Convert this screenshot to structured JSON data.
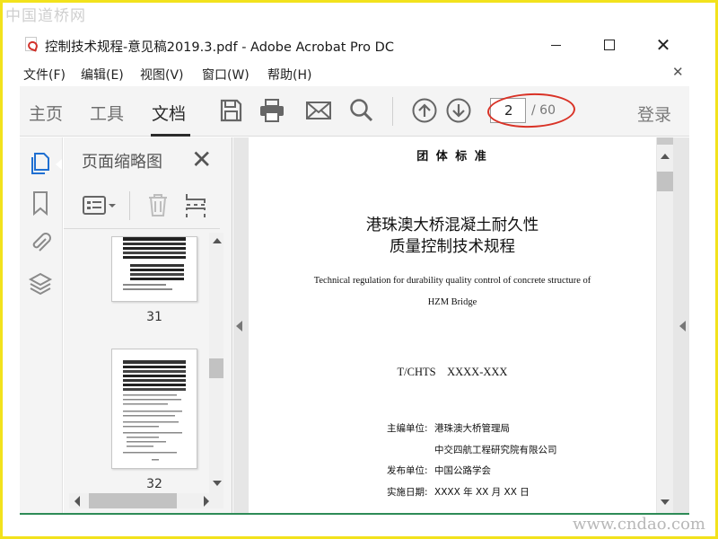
{
  "watermark": {
    "top": "中国道桥网",
    "bottom": "www.cndao.com"
  },
  "window": {
    "title": "控制技术规程-意见稿2019.3.pdf - Adobe Acrobat Pro DC"
  },
  "menu": [
    "文件(F)",
    "编辑(E)",
    "视图(V)",
    "窗口(W)",
    "帮助(H)"
  ],
  "toolbar": {
    "tabs": [
      "主页",
      "工具",
      "文档"
    ],
    "active_tab": "文档",
    "page_current": "2",
    "page_total": "/ 60",
    "login": "登录"
  },
  "sidebar": {
    "panel_title": "页面缩略图",
    "thumbnails": [
      {
        "page": "31"
      },
      {
        "page": "32"
      }
    ]
  },
  "document": {
    "header": "团  体  标  准",
    "title_line1": "港珠澳大桥混凝土耐久性",
    "title_line2": "质量控制技术规程",
    "en_title_line1": "Technical regulation for durability quality control of concrete structure of",
    "en_title_line2": "HZM Bridge",
    "code": "T/CHTS    XXXX-XXX",
    "editor_label": "主编单位:",
    "editor1": "港珠澳大桥管理局",
    "editor2": "中交四航工程研究院有限公司",
    "publisher_label": "发布单位:",
    "publisher": "中国公路学会",
    "date_label": "实施日期:",
    "date": "XXXX 年 XX 月 XX 日"
  },
  "colors": {
    "highlight_ellipse": "#d93226",
    "frame": "#f2e21c",
    "toolbar_bg": "#f4f4f4",
    "active_icon": "#1f6fd1"
  }
}
